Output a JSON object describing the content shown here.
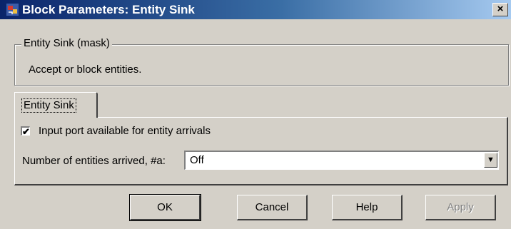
{
  "window": {
    "title": "Block Parameters: Entity Sink",
    "close_label": "×",
    "title_bar_colors": [
      "#0a246a",
      "#a6caf0"
    ],
    "icon": "simulink-block-icon"
  },
  "mask": {
    "group_title": "Entity Sink (mask)",
    "description": "Accept or block entities."
  },
  "tabs": [
    {
      "label": "Entity Sink",
      "selected": true
    }
  ],
  "params": {
    "checkbox_label": "Input port available for entity arrivals",
    "checkbox_checked": true,
    "checkbox_mark": "✔",
    "select_label": "Number of entities arrived, #a:",
    "select_value": "Off",
    "select_arrow": "▼"
  },
  "buttons": {
    "ok": "OK",
    "cancel": "Cancel",
    "help": "Help",
    "apply": "Apply"
  }
}
